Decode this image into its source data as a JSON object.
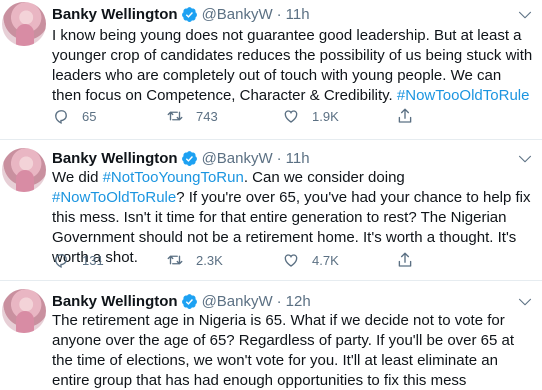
{
  "tweets": [
    {
      "name": "Banky Wellington",
      "handle": "@BankyW",
      "dot": "·",
      "time": "11h",
      "text_plain": "I know being young does not guarantee good leadership. But at least a younger crop of candidates reduces the possibility of us being stuck with leaders who are completely out of touch with young people. We can then focus on Competence, Character & Credibility. ",
      "hashtag_end": "#NowTooOldToRule",
      "replies": "65",
      "retweets": "743",
      "likes": "1.9K"
    },
    {
      "name": "Banky Wellington",
      "handle": "@BankyW",
      "dot": "·",
      "time": "11h",
      "text_a": "We did ",
      "hashtag_a": "#NotTooYoungToRun",
      "text_b": ". Can we consider doing ",
      "hashtag_b": "#NowToOldToRule",
      "text_c": "? If you're over 65, you've had your chance to help fix this mess. Isn't it time for that entire generation to rest? The Nigerian Government should not be a retirement home. It's worth a thought. It's worth a shot.",
      "replies": "131",
      "retweets": "2.3K",
      "likes": "4.7K"
    },
    {
      "name": "Banky Wellington",
      "handle": "@BankyW",
      "dot": "·",
      "time": "12h",
      "text_plain": "The retirement age in Nigeria is 65. What if we decide not to vote for anyone over the age of 65? Regardless of party. If you'll be over 65 at the time of elections, we won't vote for you. It'll at least eliminate an entire group that has had enough opportunities to fix this mess"
    }
  ],
  "icons": {
    "verified": "verified-badge-icon",
    "more": "chevron-down-icon",
    "reply": "reply-icon",
    "retweet": "retweet-icon",
    "like": "heart-icon",
    "share": "share-icon"
  },
  "colors": {
    "accent": "#1da1f2",
    "hashtag": "#1b95e0",
    "muted": "#5b7083",
    "divider": "#e6ecf0"
  }
}
